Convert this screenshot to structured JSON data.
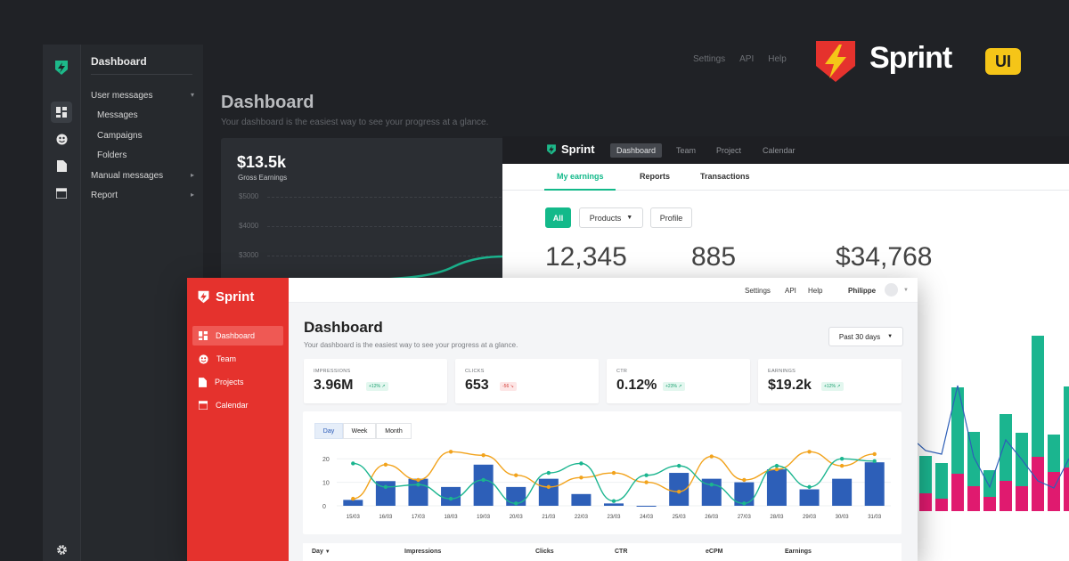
{
  "colors": {
    "brand_red": "#e5322d",
    "accent_green": "#13b98a",
    "bar_blue": "#2d5fb8",
    "line_orange": "#f2a31c",
    "line_teal": "#1bb58f",
    "magenta": "#e01a6f",
    "yellow": "#f5c518"
  },
  "brand": {
    "word": "Sprint",
    "badge": "UI"
  },
  "dark_app": {
    "nav_icons": [
      "dashboard-icon",
      "team-icon",
      "document-icon",
      "calendar-icon",
      "gear-icon"
    ],
    "sub_header": "Dashboard",
    "sub_items": [
      {
        "label": "User messages",
        "caret": "▾"
      },
      {
        "label": "Messages",
        "child": true
      },
      {
        "label": "Campaigns",
        "child": true
      },
      {
        "label": "Folders",
        "child": true
      },
      {
        "label": "Manual messages",
        "caret": "▸"
      },
      {
        "label": "Report",
        "caret": "▸"
      }
    ],
    "top_links": [
      "Settings",
      "API",
      "Help"
    ],
    "title": "Dashboard",
    "subtitle": "Your dashboard is the easiest way to see your progress at a glance.",
    "card": {
      "value": "$13.5k",
      "label": "Gross Earnings",
      "ticks": [
        "$5000",
        "$4000",
        "$3000"
      ]
    }
  },
  "white_app": {
    "logo": "Sprint",
    "nav": [
      "Dashboard",
      "Team",
      "Project",
      "Calendar"
    ],
    "tabs": [
      "My earnings",
      "Reports",
      "Transactions"
    ],
    "filters": {
      "all": "All",
      "products": "Products",
      "profile": "Profile"
    },
    "stats": [
      "12,345",
      "885",
      "$34,768"
    ]
  },
  "front_app": {
    "logo": "Sprint",
    "nav": [
      "Dashboard",
      "Team",
      "Projects",
      "Calendar"
    ],
    "top_links": [
      "Settings",
      "API",
      "Help"
    ],
    "user": "Philippe",
    "title": "Dashboard",
    "subtitle": "Your dashboard is the easiest way to see your progress at a glance.",
    "range": "Past 30 days",
    "kpis": [
      {
        "label": "IMPRESSIONS",
        "value": "3.96M",
        "badge": "+12% ↗",
        "dir": "up"
      },
      {
        "label": "CLICKS",
        "value": "653",
        "badge": "-56 ↘",
        "dir": "dn"
      },
      {
        "label": "CTR",
        "value": "0.12%",
        "badge": "+23% ↗",
        "dir": "up"
      },
      {
        "label": "EARNINGS",
        "value": "$19.2k",
        "badge": "+12% ↗",
        "dir": "up"
      }
    ],
    "segments": [
      "Day",
      "Week",
      "Month"
    ],
    "table_headers": [
      "Day",
      "Impressions",
      "Clicks",
      "CTR",
      "eCPM",
      "Earnings"
    ]
  },
  "chart_data": {
    "type": "bar",
    "categories": [
      "15/03",
      "16/03",
      "17/03",
      "18/03",
      "19/03",
      "20/03",
      "21/03",
      "22/03",
      "23/03",
      "24/03",
      "25/03",
      "26/03",
      "27/03",
      "28/03",
      "29/03",
      "30/03",
      "31/03"
    ],
    "ylim": [
      0,
      25
    ],
    "yticks": [
      0,
      10,
      20
    ],
    "series": [
      {
        "kind": "bar",
        "values": [
          2.5,
          10.5,
          11.5,
          8,
          17.5,
          8,
          11.5,
          5,
          1,
          0,
          14,
          11.5,
          10,
          15.5,
          7,
          11.5,
          18.5
        ]
      },
      {
        "kind": "line",
        "values": [
          3,
          17.5,
          11,
          23,
          21.5,
          13,
          8,
          12,
          14,
          10,
          6,
          21,
          11,
          15.5,
          23,
          17,
          22
        ]
      },
      {
        "kind": "line",
        "values": [
          18,
          8,
          9,
          3,
          11,
          1,
          14,
          18,
          2,
          13,
          17,
          9,
          1,
          17,
          8,
          20,
          19
        ]
      }
    ]
  }
}
